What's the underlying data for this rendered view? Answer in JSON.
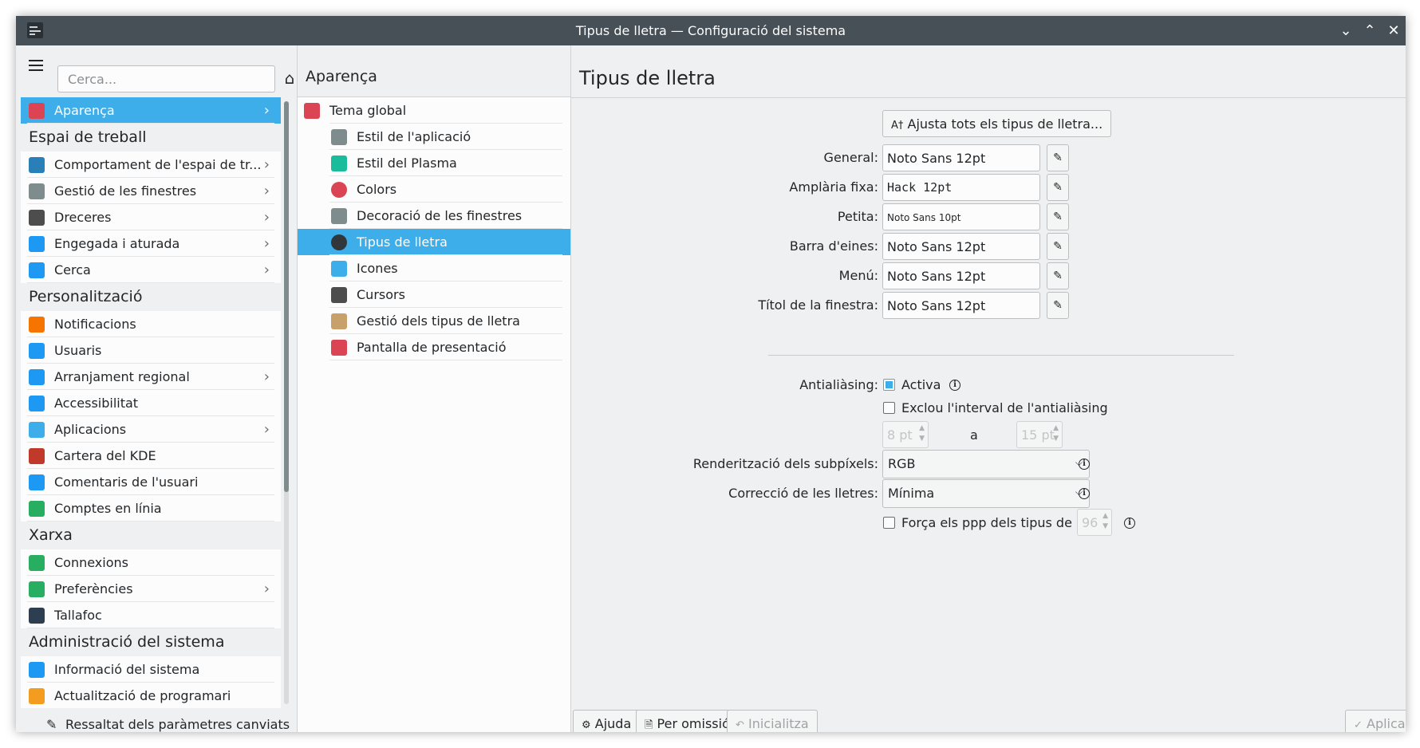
{
  "window": {
    "title": "Tipus de lletra — Configuració del sistema"
  },
  "sidebar": {
    "search_placeholder": "Cerca...",
    "entries": [
      {
        "kind": "item",
        "label": "Aparença",
        "chevron": true,
        "selected": true,
        "icon": "appearance-icon",
        "color": "#da4453"
      },
      {
        "kind": "section",
        "label": "Espai de treball"
      },
      {
        "kind": "item",
        "label": "Comportament de l'espai de tr...",
        "chevron": true,
        "icon": "workspace-icon",
        "color": "#2980b9"
      },
      {
        "kind": "item",
        "label": "Gestió de les finestres",
        "chevron": true,
        "icon": "window-icon",
        "color": "#7f8c8d"
      },
      {
        "kind": "item",
        "label": "Dreceres",
        "chevron": true,
        "icon": "keyboard-icon",
        "color": "#4d4d4d"
      },
      {
        "kind": "item",
        "label": "Engegada i aturada",
        "chevron": true,
        "icon": "monitor-icon",
        "color": "#1d99f3"
      },
      {
        "kind": "item",
        "label": "Cerca",
        "chevron": true,
        "icon": "search-icon",
        "color": "#1d99f3"
      },
      {
        "kind": "section",
        "label": "Personalització"
      },
      {
        "kind": "item",
        "label": "Notificacions",
        "chevron": false,
        "icon": "bell-icon",
        "color": "#f67400"
      },
      {
        "kind": "item",
        "label": "Usuaris",
        "chevron": false,
        "icon": "users-icon",
        "color": "#1d99f3"
      },
      {
        "kind": "item",
        "label": "Arranjament regional",
        "chevron": true,
        "icon": "chat-icon",
        "color": "#1d99f3"
      },
      {
        "kind": "item",
        "label": "Accessibilitat",
        "chevron": false,
        "icon": "accessibility-icon",
        "color": "#1d99f3"
      },
      {
        "kind": "item",
        "label": "Aplicacions",
        "chevron": true,
        "icon": "applications-icon",
        "color": "#3daee9"
      },
      {
        "kind": "item",
        "label": "Cartera del KDE",
        "chevron": false,
        "icon": "wallet-icon",
        "color": "#c0392b"
      },
      {
        "kind": "item",
        "label": "Comentaris de l'usuari",
        "chevron": false,
        "icon": "feedback-icon",
        "color": "#1d99f3"
      },
      {
        "kind": "item",
        "label": "Comptes en línia",
        "chevron": false,
        "icon": "globe-icon",
        "color": "#27ae60"
      },
      {
        "kind": "section",
        "label": "Xarxa"
      },
      {
        "kind": "item",
        "label": "Connexions",
        "chevron": false,
        "icon": "globe-icon",
        "color": "#27ae60"
      },
      {
        "kind": "item",
        "label": "Preferències",
        "chevron": true,
        "icon": "globe-icon",
        "color": "#27ae60"
      },
      {
        "kind": "item",
        "label": "Tallafoc",
        "chevron": false,
        "icon": "firewall-icon",
        "color": "#2c3e50"
      },
      {
        "kind": "section",
        "label": "Administració del sistema"
      },
      {
        "kind": "item",
        "label": "Informació del sistema",
        "chevron": false,
        "icon": "info-icon",
        "color": "#1d99f3"
      },
      {
        "kind": "item",
        "label": "Actualització de programari",
        "chevron": false,
        "icon": "update-icon",
        "color": "#f39c1f"
      }
    ],
    "highlight_button": "Ressaltat dels paràmetres canviats"
  },
  "middle": {
    "header": "Aparença",
    "items": [
      {
        "label": "Tema global",
        "first": true,
        "selected": false,
        "icon": "global-theme-icon",
        "color": "#da4453"
      },
      {
        "label": "Estil de l'aplicació",
        "selected": false,
        "icon": "app-style-icon",
        "color": "#7f8c8d"
      },
      {
        "label": "Estil del Plasma",
        "selected": false,
        "icon": "plasma-style-icon",
        "color": "#1abc9c"
      },
      {
        "label": "Colors",
        "selected": false,
        "icon": "colors-icon",
        "color": "#da4453"
      },
      {
        "label": "Decoració de les finestres",
        "selected": false,
        "icon": "window-decoration-icon",
        "color": "#7f8c8d"
      },
      {
        "label": "Tipus de lletra",
        "selected": true,
        "icon": "fonts-icon",
        "color": "#31363b"
      },
      {
        "label": "Icones",
        "selected": false,
        "icon": "icons-icon",
        "color": "#3daee9"
      },
      {
        "label": "Cursors",
        "selected": false,
        "icon": "cursor-icon",
        "color": "#4d4d4d"
      },
      {
        "label": "Gestió dels tipus de lletra",
        "selected": false,
        "icon": "font-management-icon",
        "color": "#c8a06a"
      },
      {
        "label": "Pantalla de presentació",
        "selected": false,
        "icon": "splash-icon",
        "color": "#da4453"
      }
    ]
  },
  "content": {
    "title": "Tipus de lletra",
    "adjust_all_button": "Ajusta tots els tipus de lletra...",
    "font_rows": [
      {
        "label": "General:",
        "value": "Noto Sans 12pt",
        "style": ""
      },
      {
        "label": "Amplària fixa:",
        "value": "Hack 12pt",
        "style": "mono"
      },
      {
        "label": "Petita:",
        "value": "Noto Sans 10pt",
        "style": "small"
      },
      {
        "label": "Barra d'eines:",
        "value": "Noto Sans 12pt",
        "style": ""
      },
      {
        "label": "Menú:",
        "value": "Noto Sans 12pt",
        "style": ""
      },
      {
        "label": "Títol de la finestra:",
        "value": "Noto Sans 12pt",
        "style": ""
      }
    ],
    "antialiasing": {
      "label": "Antialiàsing:",
      "enable_label": "Activa",
      "enabled": true,
      "exclude_label": "Exclou l'interval de l'antialiàsing",
      "exclude_checked": false,
      "from_value": "8 pt",
      "to_label": "a",
      "to_value": "15 pt"
    },
    "subpixel": {
      "label": "Renderització dels subpíxels:",
      "value": "RGB"
    },
    "hinting": {
      "label": "Correcció de les lletres:",
      "value": "Mínima"
    },
    "force_dpi": {
      "label": "Força els ppp dels tipus de lletra:",
      "checked": false,
      "value": "96"
    }
  },
  "footer": {
    "help": "Ajuda",
    "defaults": "Per omissió",
    "reset": "Inicialitza",
    "apply": "Aplica"
  }
}
